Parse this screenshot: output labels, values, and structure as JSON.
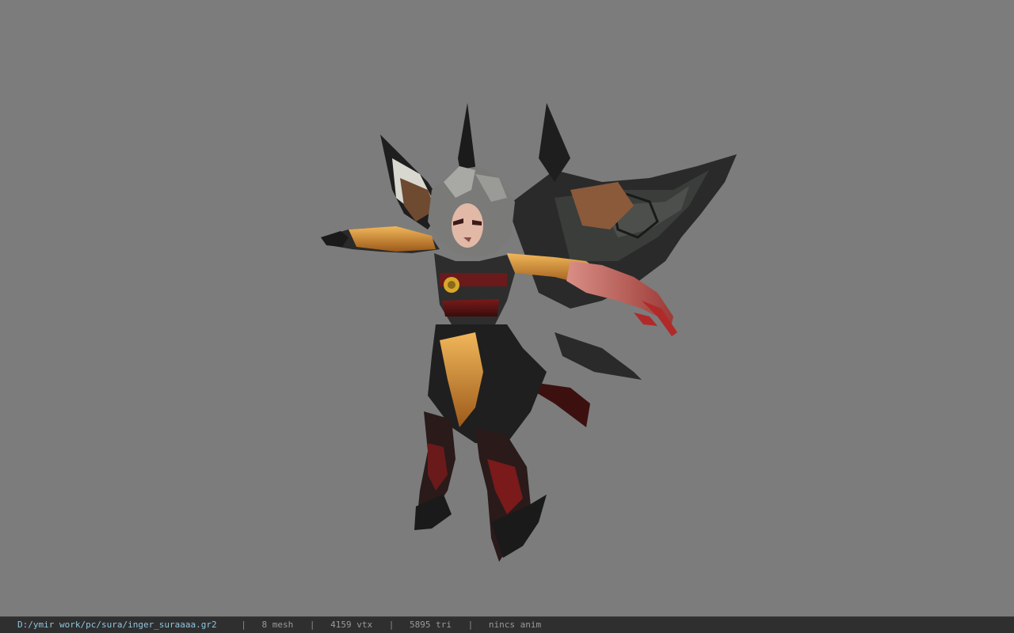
{
  "viewer": {
    "background_color": "#7c7c7c",
    "model_name": "inger_suraaaa"
  },
  "status_bar": {
    "file_path": "D:/ymir work/pc/sura/inger_suraaaa.gr2",
    "separator": "|",
    "mesh": "8 mesh",
    "vertices": "4159 vtx",
    "triangles": "5895 tri",
    "animation": "nincs anim",
    "path_color": "#8ec6e0",
    "bar_color": "#2f2f2f"
  }
}
